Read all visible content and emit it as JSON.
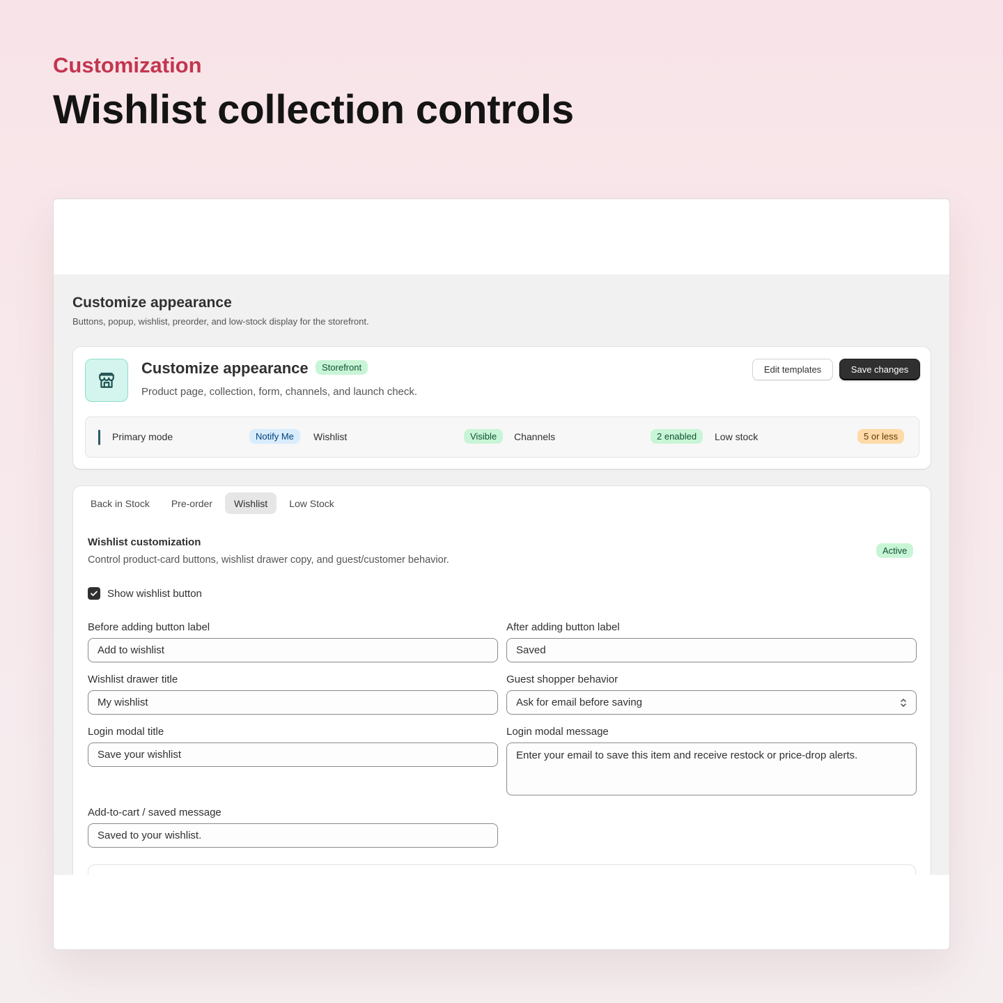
{
  "hero": {
    "eyebrow": "Customization",
    "headline": "Wishlist collection controls"
  },
  "page": {
    "title": "Customize appearance",
    "subtitle": "Buttons, popup, wishlist, preorder, and low-stock display for the storefront."
  },
  "header_card": {
    "icon": "store-icon",
    "title": "Customize appearance",
    "badge": "Storefront",
    "description": "Product page, collection, form, channels, and launch check.",
    "edit_button": "Edit templates",
    "save_button": "Save changes"
  },
  "summary": {
    "items": [
      {
        "label": "Primary mode",
        "badge": "Notify Me",
        "tone": "blue"
      },
      {
        "label": "Wishlist",
        "badge": "Visible",
        "tone": "green"
      },
      {
        "label": "Channels",
        "badge": "2 enabled",
        "tone": "green"
      },
      {
        "label": "Low stock",
        "badge": "5 or less",
        "tone": "orange"
      }
    ]
  },
  "tabs": [
    {
      "label": "Back in Stock",
      "active": false
    },
    {
      "label": "Pre-order",
      "active": false
    },
    {
      "label": "Wishlist",
      "active": true
    },
    {
      "label": "Low Stock",
      "active": false
    }
  ],
  "section": {
    "title": "Wishlist customization",
    "description": "Control product-card buttons, wishlist drawer copy, and guest/customer behavior.",
    "status": "Active",
    "checkbox_label": "Show wishlist button",
    "checkbox_checked": true
  },
  "fields": {
    "before_label": {
      "label": "Before adding button label",
      "value": "Add to wishlist"
    },
    "after_label": {
      "label": "After adding button label",
      "value": "Saved"
    },
    "drawer_title": {
      "label": "Wishlist drawer title",
      "value": "My wishlist"
    },
    "guest_behavior": {
      "label": "Guest shopper behavior",
      "value": "Ask for email before saving"
    },
    "login_title": {
      "label": "Login modal title",
      "value": "Save your wishlist"
    },
    "login_message": {
      "label": "Login modal message",
      "value": "Enter your email to save this item and receive restock or price-drop alerts."
    },
    "saved_message": {
      "label": "Add-to-cart / saved message",
      "value": "Saved to your wishlist."
    }
  },
  "colors": {
    "accent": "#c2364f",
    "primary_button": "#303030",
    "success_badge": "#c8f5d6",
    "info_badge": "#d8ecfc",
    "warning_badge": "#ffd9a8"
  }
}
